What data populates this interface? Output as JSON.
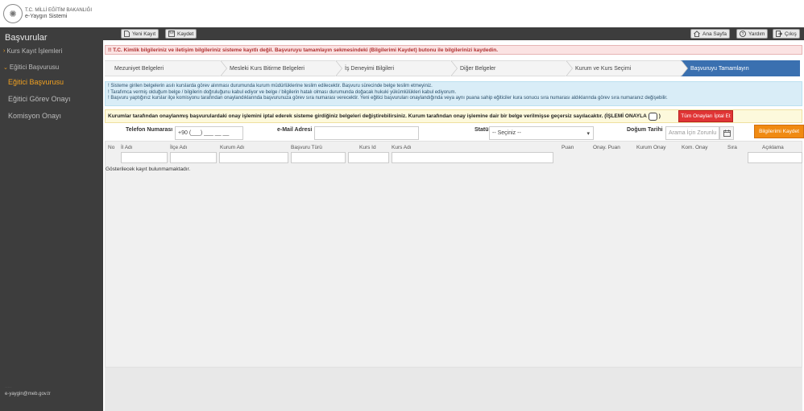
{
  "logo": {
    "line1": "T.C. MİLLİ EĞİTİM BAKANLIĞI",
    "line2": "e-Yaygın Sistemi"
  },
  "sidebar": {
    "title": "Başvurular",
    "items": [
      {
        "label": "Kurs Kayıt İşlemleri"
      },
      {
        "label": "Eğitici Başvurusu"
      }
    ],
    "sub_items": [
      {
        "label": "Eğitici Başvurusu",
        "active": true
      },
      {
        "label": "Eğitici Görev Onayı",
        "active": false
      },
      {
        "label": "Komisyon Onayı",
        "active": false
      }
    ],
    "user_email": "e-yaygin@meb.gov.tr"
  },
  "toolbar": {
    "new_record": "Yeni Kayıt",
    "save": "Kaydet",
    "home": "Ana Sayfa",
    "help": "Yardım",
    "exit": "Çıkış"
  },
  "alert": "!! T.C. Kimlik bilgileriniz ve iletişim bilgileriniz sisteme kayıtlı değil. Başvuruyu tamamlayın sekmesindeki (Bilgilerimi Kaydet) butonu ile bilgilerinizi kaydedin.",
  "steps": [
    {
      "label": "Mezuniyet Belgeleri",
      "active": false
    },
    {
      "label": "Mesleki Kurs Bitirme Belgeleri",
      "active": false
    },
    {
      "label": "İş Deneyimi Bilgileri",
      "active": false
    },
    {
      "label": "Diğer Belgeler",
      "active": false
    },
    {
      "label": "Kurum ve Kurs Seçimi",
      "active": false
    },
    {
      "label": "Başvuruyu Tamamlayın",
      "active": true
    }
  ],
  "info": [
    "! Sisteme girilen belgelerin asılı kurslarda görev alınması durumunda kurum müdürlüklerine teslim edilecektir. Başvuru sürecinde belge teslim etmeyiniz.",
    "! Tarafımca vermiş olduğum belge / bilgilerin doğruluğunu kabul ediyor ve belge / bilgilerin hatalı olması durumunda doğacak hukuki yükümlülükleri kabul ediyorum.",
    "! Başvuru yaptığınız kurslar ilçe komisyonu tarafından onaylandıklarında başvurunuza görev sıra numarası verecektir. Yeni eğitici başvuruları onaylandığında veya aynı puana sahip eğiticiler kura sonucu sıra numarası aldıklarında görev sıra numaranız değişebilir."
  ],
  "warning": {
    "text": "Kurumlar tarafından onaylanmış başvurulardaki onay işlemini iptal ederek sisteme girdiğiniz belgeleri değiştirebilirsiniz. Kurum tarafından onay işlemine dair bir belge verilmişse geçersiz sayılacaktır. (İŞLEMİ ONAYLA",
    "close": ")",
    "cancel_button": "Tüm Onayları İptal Et"
  },
  "form": {
    "phone_label": "Telefon Numarası",
    "phone_value": "+90 (___) ___ __ __",
    "email_label": "e-Mail Adresi",
    "email_value": "",
    "status_label": "Statü",
    "status_value": "-- Seçiniz --",
    "birth_label": "Doğum Tarihi",
    "birth_placeholder": "Arama İçin Zorunlu",
    "save_info_button": "Bilgilerimi Kaydet"
  },
  "table": {
    "headers": [
      "No",
      "İl Adı",
      "İlçe Adı",
      "Kurum Adı",
      "Başvuru Türü",
      "Kurs Id",
      "Kurs Adı",
      "Puan",
      "Onay. Puan",
      "Kurum Onay",
      "Kom. Onay",
      "Sıra",
      "Açıklama"
    ],
    "empty_message": "Gösterilecek kayıt bulunmamaktadır."
  },
  "colors": {
    "sidebar": "#3d3d3d",
    "accent": "#f0a020",
    "active_step": "#3a70b0",
    "alert_red": "#e03535",
    "orange": "#f08a12"
  }
}
